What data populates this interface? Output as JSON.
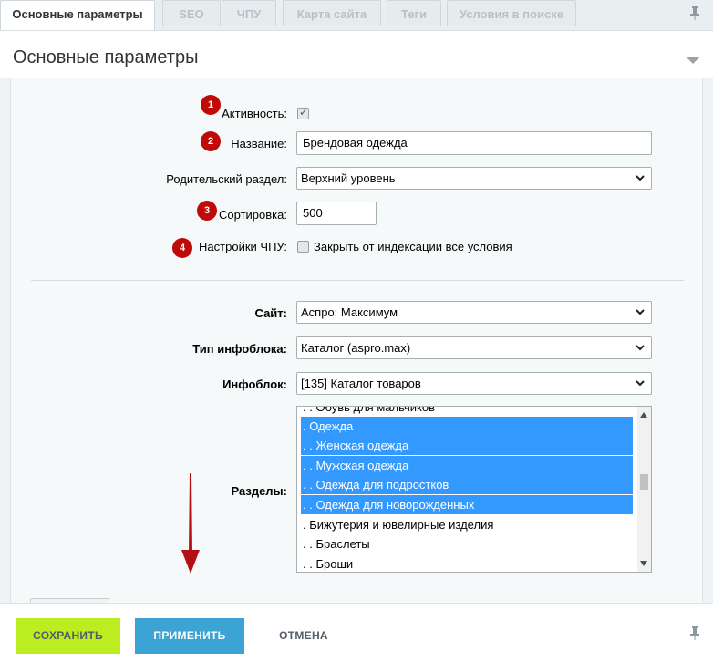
{
  "tabs": [
    {
      "label": "Основные параметры"
    },
    {
      "label": "SEO"
    },
    {
      "label": "ЧПУ"
    },
    {
      "label": "Карта сайта"
    },
    {
      "label": "Теги"
    },
    {
      "label": "Условия в поиске"
    }
  ],
  "header": {
    "title": "Основные параметры"
  },
  "form": {
    "active": {
      "label": "Активность:",
      "badge": "1",
      "checked": true
    },
    "name": {
      "label": "Название:",
      "badge": "2",
      "value": "Брендовая одежда"
    },
    "parent": {
      "label": "Родительский раздел:",
      "value": "Верхний уровень"
    },
    "sort": {
      "label": "Сортировка:",
      "badge": "3",
      "value": "500"
    },
    "seo": {
      "label": "Настройки ЧПУ:",
      "badge": "4",
      "checkbox_label": "Закрыть от индексации все условия",
      "checked": false
    },
    "site": {
      "label": "Сайт:",
      "value": "Аспро: Максимум"
    },
    "iblock_type": {
      "label": "Тип инфоблока:",
      "value": "Каталог (aspro.max)"
    },
    "iblock": {
      "label": "Инфоблок:",
      "value": "[135] Каталог товаров"
    },
    "sections": {
      "label": "Разделы:",
      "options": [
        {
          "text": ". . Обувь для мальчиков",
          "selected": false
        },
        {
          "text": ". Одежда",
          "selected": true
        },
        {
          "text": ". . Женская одежда",
          "selected": true
        },
        {
          "text": ". . Мужская одежда",
          "selected": true
        },
        {
          "text": ". . Одежда для подростков",
          "selected": true
        },
        {
          "text": ". . Одежда для новорожденных",
          "selected": true
        },
        {
          "text": ". Бижутерия и ювелирные изделия",
          "selected": false
        },
        {
          "text": ". . Браслеты",
          "selected": false
        },
        {
          "text": ". . Броши",
          "selected": false
        }
      ]
    }
  },
  "footer": {
    "save": "СОХРАНИТЬ",
    "apply": "ПРИМЕНИТЬ",
    "cancel": "ОТМЕНА"
  },
  "icons": {
    "pin": "pin-icon",
    "collapse": "chevron-down-icon",
    "dropdown": "chevron-down-icon",
    "annotation": "red-arrow"
  },
  "colors": {
    "save_button": "#bbed21",
    "apply_button": "#3ca4d4",
    "selection": "#3399ff",
    "badge": "#c00a0a",
    "arrow": "#b30f14"
  }
}
